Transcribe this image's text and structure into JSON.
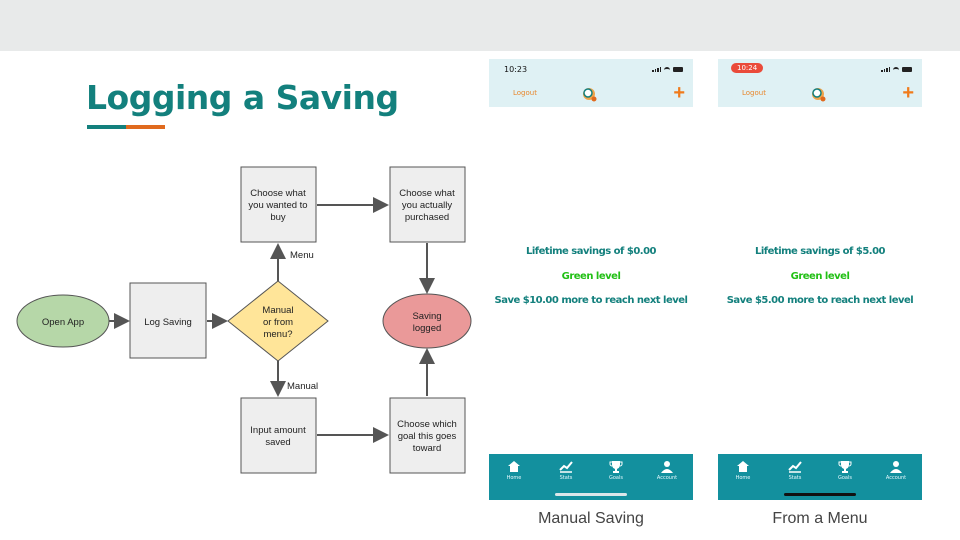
{
  "slide": {
    "title": "Logging a Saving",
    "accent_colors": {
      "teal": "#13807d",
      "orange": "#e06a1e"
    }
  },
  "flowchart": {
    "nodes": {
      "open_app": "Open App",
      "log_saving": "Log Saving",
      "decision": [
        "Manual",
        "or from",
        "menu?"
      ],
      "choose_wanted": [
        "Choose what",
        "you wanted to",
        "buy"
      ],
      "choose_purchased": [
        "Choose what",
        "you actually",
        "purchased"
      ],
      "input_amount": [
        "Input amount",
        "saved"
      ],
      "choose_goal": [
        "Choose which",
        "goal this goes",
        "toward"
      ],
      "saving_logged": [
        "Saving",
        "logged"
      ]
    },
    "edge_labels": {
      "menu": "Menu",
      "manual": "Manual"
    },
    "colors": {
      "start": "#b6d7a8",
      "decision": "#ffe599",
      "end": "#ea9999",
      "process": "#eeeeee"
    }
  },
  "phones": [
    {
      "time": "10:23",
      "time_style": "plain",
      "nav": {
        "logout": "Logout",
        "add_symbol": "+"
      },
      "lifetime": "Lifetime savings of $0.00",
      "level": "Green level",
      "next": "Save $10.00 more to reach next level",
      "tabs": [
        {
          "label": "Home",
          "icon": "home-icon"
        },
        {
          "label": "Stats",
          "icon": "stats-icon"
        },
        {
          "label": "Goals",
          "icon": "trophy-icon"
        },
        {
          "label": "Account",
          "icon": "person-icon"
        }
      ],
      "home_indicator_color": "#dbe7ea",
      "caption": "Manual Saving"
    },
    {
      "time": "10:24",
      "time_style": "pill",
      "nav": {
        "logout": "Logout",
        "add_symbol": "+"
      },
      "lifetime": "Lifetime savings of $5.00",
      "level": "Green level",
      "next": "Save $5.00 more to reach next level",
      "tabs": [
        {
          "label": "Home",
          "icon": "home-icon"
        },
        {
          "label": "Stats",
          "icon": "stats-icon"
        },
        {
          "label": "Goals",
          "icon": "trophy-icon"
        },
        {
          "label": "Account",
          "icon": "person-icon"
        }
      ],
      "home_indicator_color": "#111111",
      "caption": "From a Menu"
    }
  ]
}
